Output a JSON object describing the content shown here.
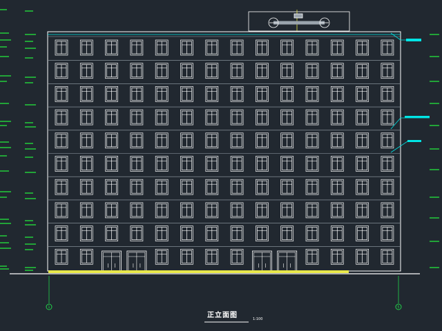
{
  "drawing": {
    "title": "正立面图",
    "scale": "1:100",
    "floors": 10,
    "window_columns": 14,
    "entrance_door_pairs": 2,
    "axis_markers": [
      {
        "label": "1"
      },
      {
        "label": "5"
      }
    ],
    "colors": {
      "background": "#212830",
      "outline": "#ffffff",
      "gridline": "#9aa4ad",
      "annotation": "#00e5e5",
      "ground_band": "#e8e84a",
      "axis": "#22d14a",
      "margin_marks": "#22c43a"
    }
  }
}
